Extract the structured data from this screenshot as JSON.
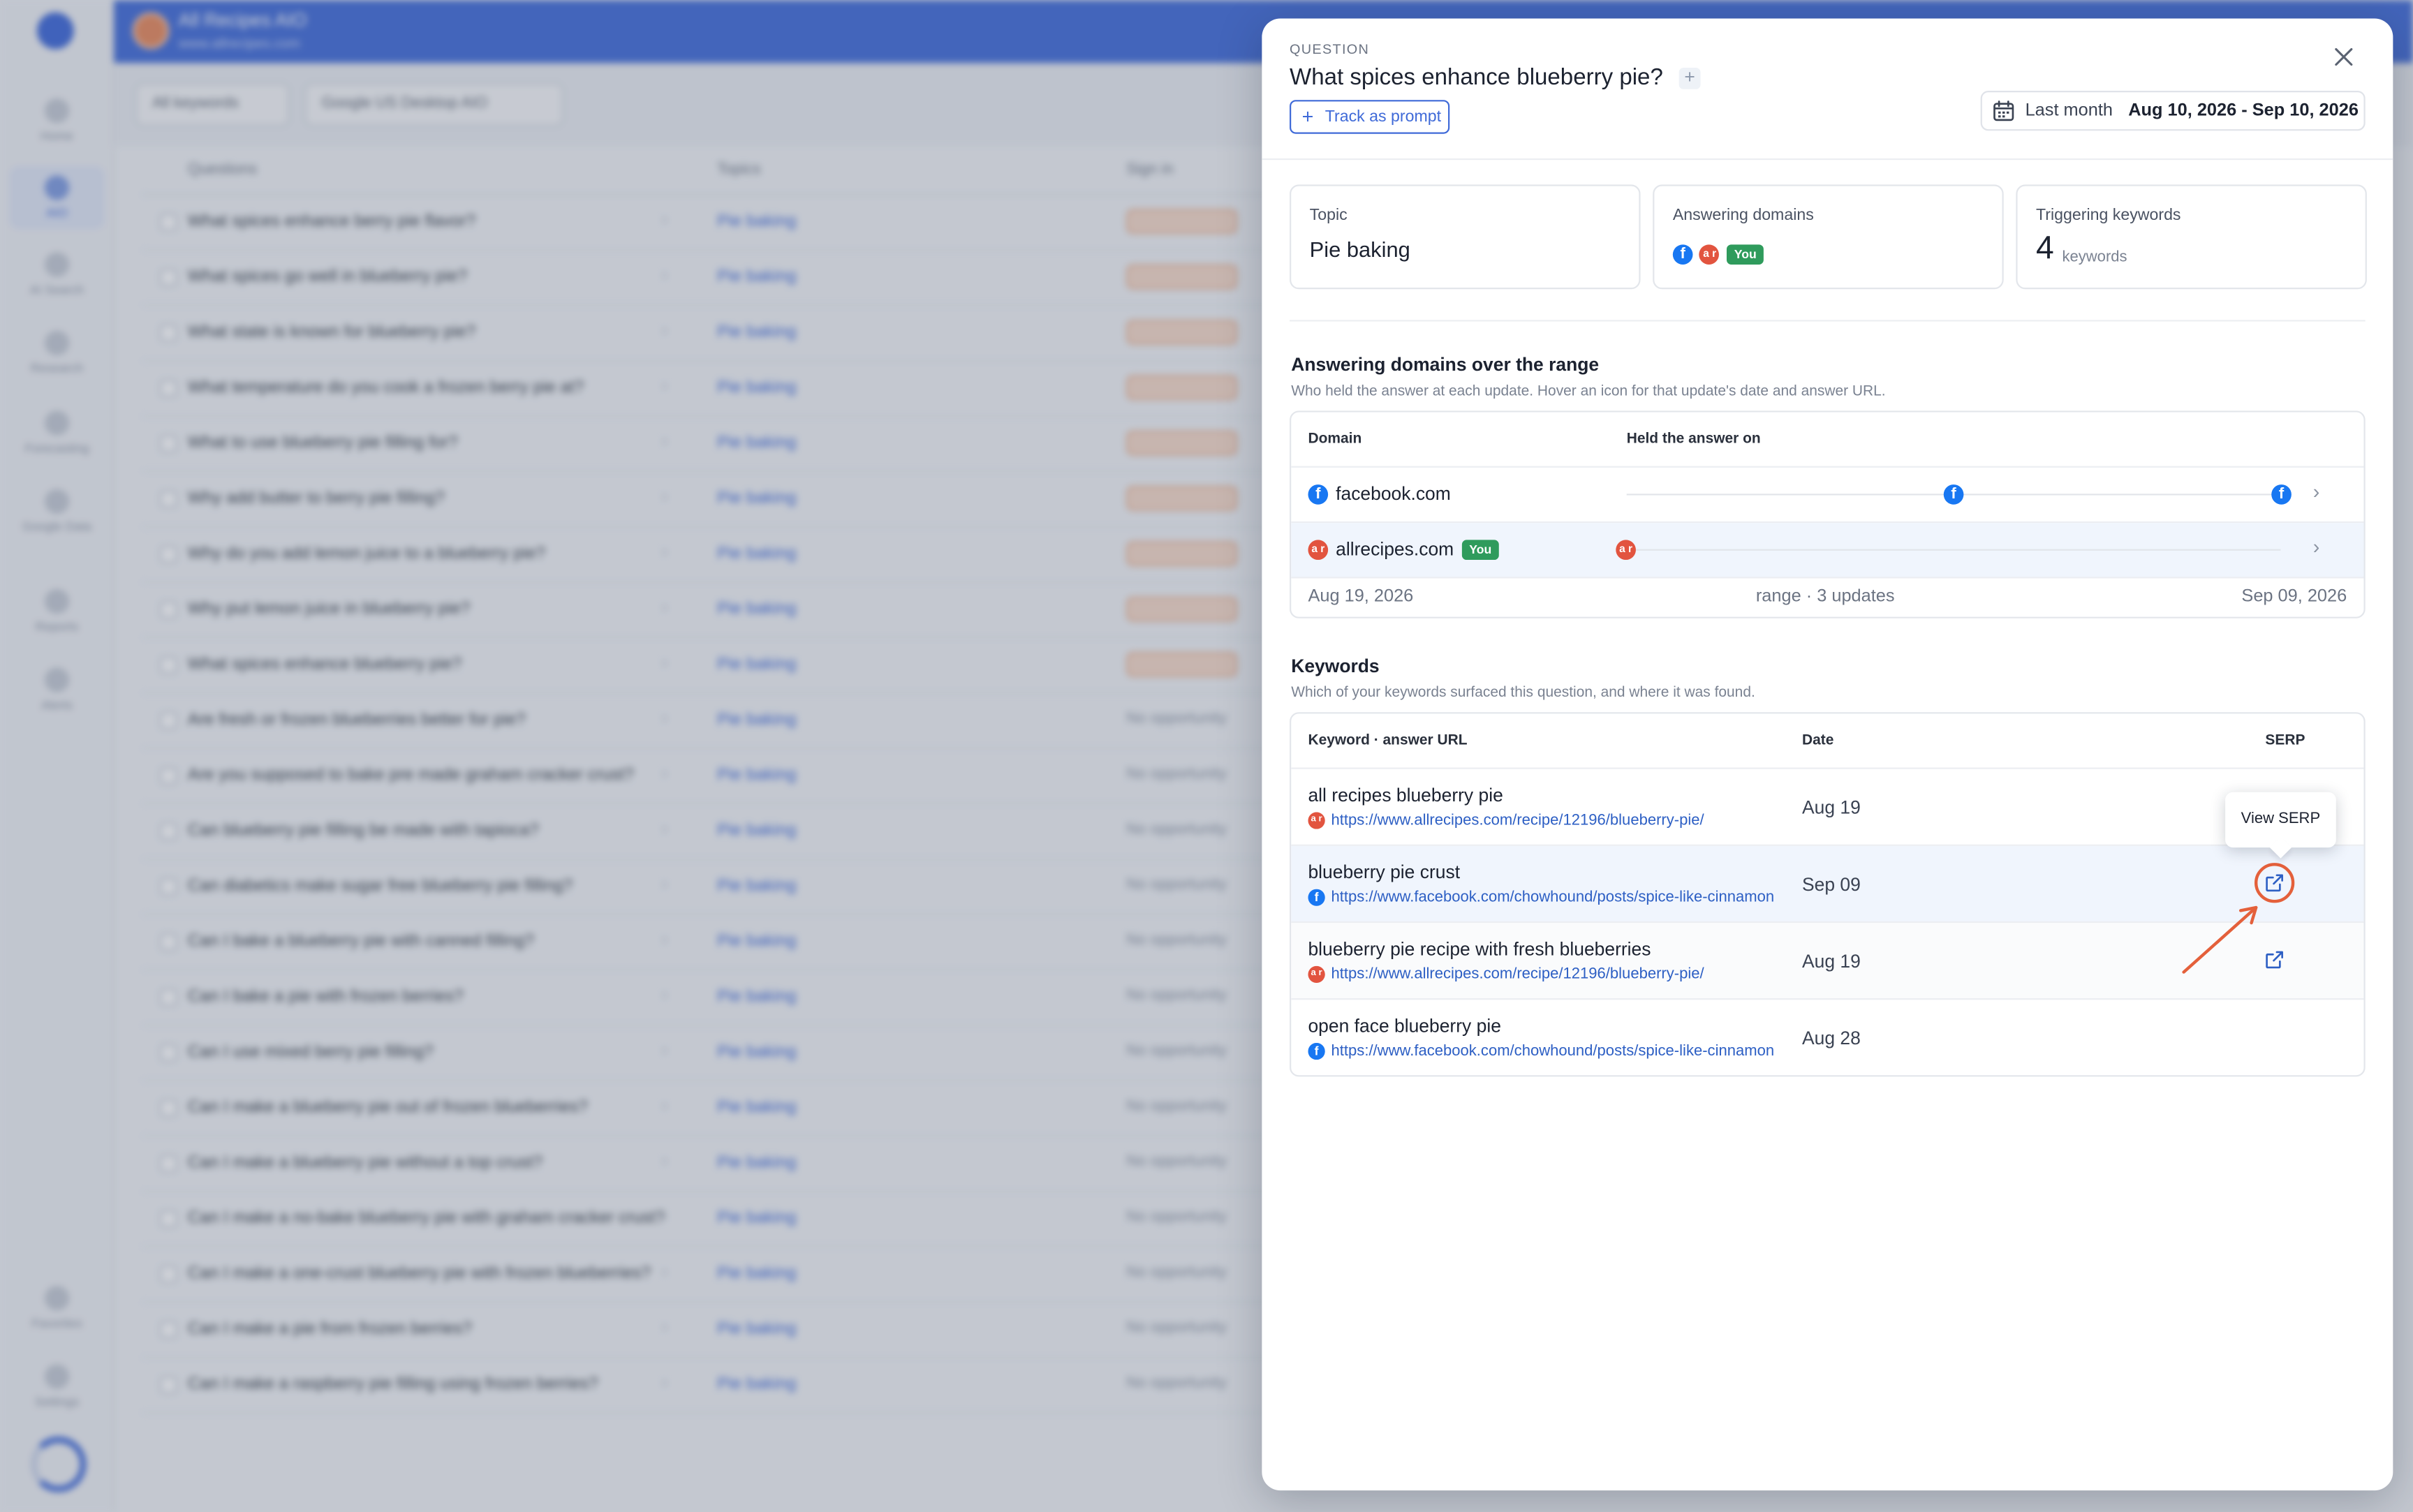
{
  "background": {
    "brand_name": "All Recipes AIO",
    "brand_url": "www.allrecipes.com",
    "nav": [
      "Home",
      "AIO",
      "AI Search",
      "Research",
      "Forecasting",
      "Google Data",
      "Reports",
      "Alerts",
      "Favorites",
      "Settings"
    ],
    "filters": [
      "All keywords",
      "Google US Desktop AIO"
    ],
    "columns": [
      "Questions",
      "Topics",
      "Sign in"
    ],
    "rows": [
      "What spices enhance berry pie flavor?",
      "What spices go well in blueberry pie?",
      "What state is known for blueberry pie?",
      "What temperature do you cook a frozen berry pie at?",
      "What to use blueberry pie filling for?",
      "Why add butter to berry pie filling?",
      "Why do you add lemon juice to a blueberry pie?",
      "Why put lemon juice in blueberry pie?",
      "What spices enhance blueberry pie?",
      "Are fresh or frozen blueberries better for pie?",
      "Are you supposed to bake pre made graham cracker crust?",
      "Can blueberry pie filling be made with tapioca?",
      "Can diabetics make sugar free blueberry pie filling?",
      "Can I bake a blueberry pie with canned filling?",
      "Can I bake a pie with frozen berries?",
      "Can I use mixed berry pie filling?",
      "Can I make a blueberry pie out of frozen blueberries?",
      "Can I make a blueberry pie without a top crust?",
      "Can I make a no-bake blueberry pie with graham cracker crust?",
      "Can I make a one-crust blueberry pie with frozen blueberries?",
      "Can I make a pie from frozen berries?",
      "Can I make a raspberry pie filling using frozen berries?"
    ],
    "row_topic": "Pie baking",
    "no_opportunity": "No opportunity"
  },
  "panel": {
    "eyebrow": "QUESTION",
    "title": "What spices enhance blueberry pie?",
    "track_label": "Track as prompt",
    "date_label": "Last month",
    "date_value": "Aug 10, 2026 - Sep 10, 2026",
    "topic_label": "Topic",
    "topic_value": "Pie baking",
    "answering_label": "Answering domains",
    "you_label": "You",
    "triggering_label": "Triggering keywords",
    "triggering_count": "4",
    "triggering_unit": "keywords"
  },
  "domains_section": {
    "title": "Answering domains over the range",
    "subtitle": "Who held the answer at each update. Hover an icon for that update's date and answer URL.",
    "col_domain": "Domain",
    "col_held": "Held the answer on",
    "rows": [
      {
        "domain": "facebook.com",
        "icon": "facebook-icon"
      },
      {
        "domain": "allrecipes.com",
        "icon": "allrecipes-icon",
        "badge": "You"
      }
    ],
    "range_start": "Aug 19, 2026",
    "range_mid": "range · 3 updates",
    "range_end": "Sep 09, 2026"
  },
  "keywords_section": {
    "title": "Keywords",
    "subtitle": "Which of your keywords surfaced this question, and where it was found.",
    "col_keyword": "Keyword · answer URL",
    "col_date": "Date",
    "col_serp": "SERP",
    "rows": [
      {
        "keyword": "all recipes blueberry pie",
        "url": "https://www.allrecipes.com/recipe/12196/blueberry-pie/",
        "source": "allrecipes",
        "date": "Aug 19"
      },
      {
        "keyword": "blueberry pie crust",
        "url": "https://www.facebook.com/chowhound/posts/spice-like-cinnamon",
        "source": "facebook",
        "date": "Sep 09"
      },
      {
        "keyword": "blueberry pie recipe with fresh blueberries",
        "url": "https://www.allrecipes.com/recipe/12196/blueberry-pie/",
        "source": "allrecipes",
        "date": "Aug 19"
      },
      {
        "keyword": "open face blueberry pie",
        "url": "https://www.facebook.com/chowhound/posts/spice-like-cinnamon",
        "source": "facebook",
        "date": "Aug 28"
      }
    ],
    "tooltip": "View SERP"
  },
  "icons": {
    "facebook_glyph": "f",
    "allrecipes_glyph": "a r"
  },
  "colors": {
    "accent": "#3f6ad8",
    "you_badge": "#2f9b5c",
    "facebook": "#1877f2",
    "allrecipes": "#e2543f",
    "annotation": "#e4603b"
  }
}
